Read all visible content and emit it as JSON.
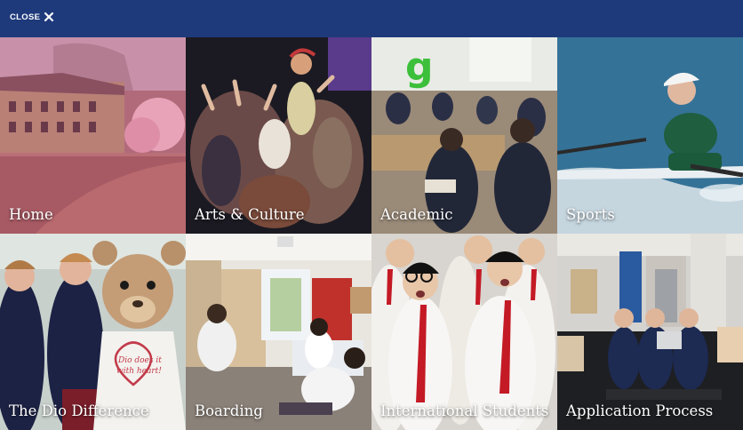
{
  "header": {
    "close_label": "CLOSE"
  },
  "tiles": [
    {
      "label": "Home"
    },
    {
      "label": "Arts & Culture"
    },
    {
      "label": "Academic"
    },
    {
      "label": "Sports"
    },
    {
      "label": "The Dio Difference"
    },
    {
      "label": "Boarding"
    },
    {
      "label": "International Students"
    },
    {
      "label": "Application Process"
    }
  ],
  "colors": {
    "header": "#1e3a7b",
    "label_text": "#ffffff"
  }
}
